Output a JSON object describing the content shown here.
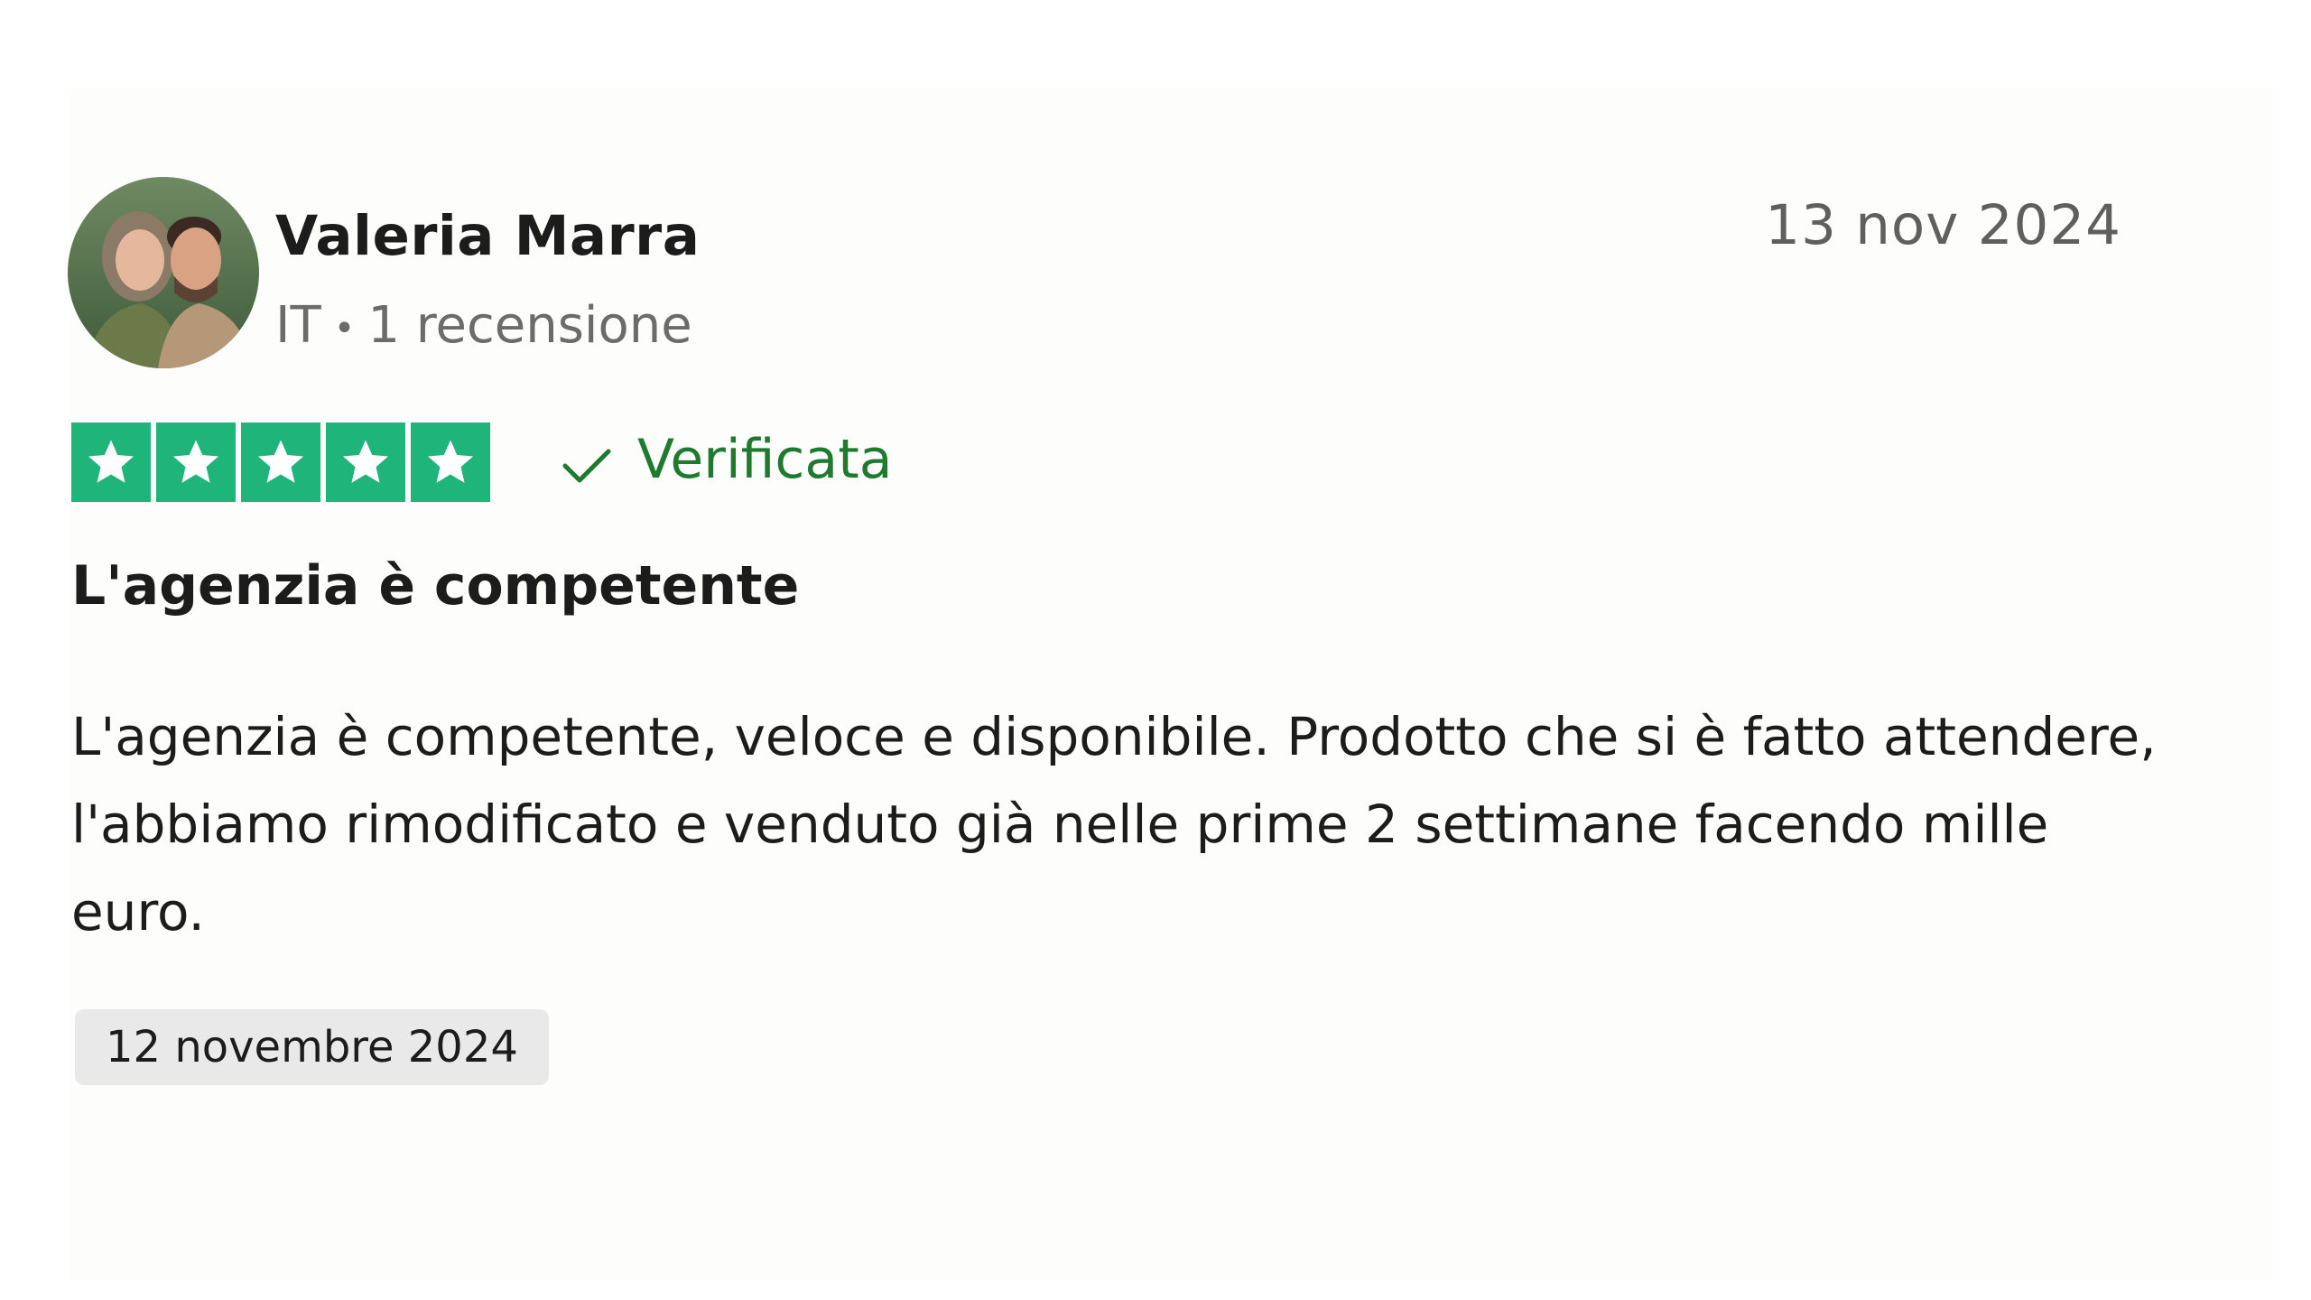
{
  "reviewer": {
    "name": "Valeria  Marra",
    "country": "IT",
    "separator": "•",
    "review_count": "1 recensione",
    "avatar_icon": "avatar-photo"
  },
  "review": {
    "date_posted": "13 nov 2024",
    "rating": 5,
    "rating_max": 5,
    "star_color": "#1fb57a",
    "verified_label": "Verificata",
    "verified_color": "#1d7a2e",
    "title": "L'agenzia è competente",
    "body": "L'agenzia è competente, veloce e disponibile. Prodotto che si è fatto attendere, l'abbiamo rimodificato e venduto già nelle prime 2 settimane facendo mille euro.",
    "experience_date": "12 novembre 2024"
  }
}
